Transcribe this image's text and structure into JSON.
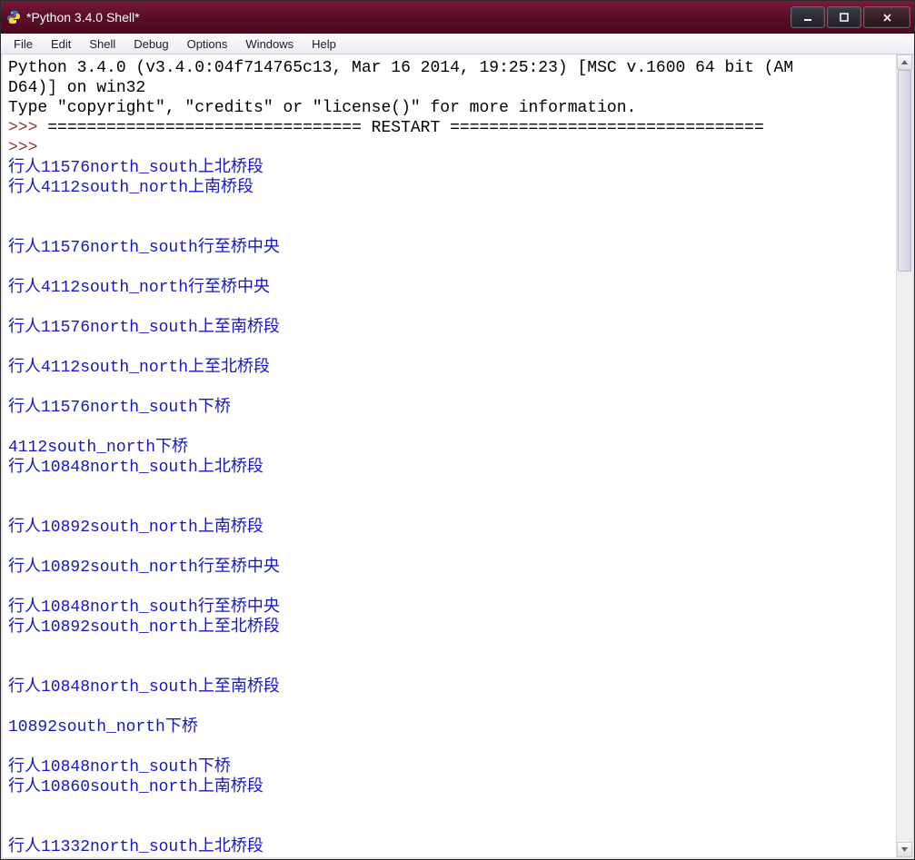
{
  "window": {
    "title": "*Python 3.4.0 Shell*"
  },
  "menubar": {
    "items": [
      "File",
      "Edit",
      "Shell",
      "Debug",
      "Options",
      "Windows",
      "Help"
    ]
  },
  "colors": {
    "prompt": "#8b3a3a",
    "output": "#1616c8",
    "black": "#000000"
  },
  "lines": [
    {
      "spans": [
        {
          "c": "black",
          "t": "Python 3.4.0 (v3.4.0:04f714765c13, Mar 16 2014, 19:25:23) [MSC v.1600 64 bit (AM"
        }
      ]
    },
    {
      "spans": [
        {
          "c": "black",
          "t": "D64)] on win32"
        }
      ]
    },
    {
      "spans": [
        {
          "c": "black",
          "t": "Type \"copyright\", \"credits\" or \"license()\" for more information."
        }
      ]
    },
    {
      "spans": [
        {
          "c": "prompt",
          "t": ">>> "
        },
        {
          "c": "black",
          "t": "================================ RESTART ================================"
        }
      ]
    },
    {
      "spans": [
        {
          "c": "prompt",
          "t": ">>> "
        }
      ]
    },
    {
      "spans": [
        {
          "c": "blue",
          "t": "行人11576north_south上北桥段"
        }
      ]
    },
    {
      "spans": [
        {
          "c": "blue",
          "t": "行人4112south_north上南桥段"
        }
      ]
    },
    {
      "spans": [
        {
          "c": "blue",
          "t": ""
        }
      ]
    },
    {
      "spans": [
        {
          "c": "blue",
          "t": ""
        }
      ]
    },
    {
      "spans": [
        {
          "c": "blue",
          "t": "行人11576north_south行至桥中央"
        }
      ]
    },
    {
      "spans": [
        {
          "c": "blue",
          "t": ""
        }
      ]
    },
    {
      "spans": [
        {
          "c": "blue",
          "t": "行人4112south_north行至桥中央"
        }
      ]
    },
    {
      "spans": [
        {
          "c": "blue",
          "t": ""
        }
      ]
    },
    {
      "spans": [
        {
          "c": "blue",
          "t": "行人11576north_south上至南桥段"
        }
      ]
    },
    {
      "spans": [
        {
          "c": "blue",
          "t": ""
        }
      ]
    },
    {
      "spans": [
        {
          "c": "blue",
          "t": "行人4112south_north上至北桥段"
        }
      ]
    },
    {
      "spans": [
        {
          "c": "blue",
          "t": ""
        }
      ]
    },
    {
      "spans": [
        {
          "c": "blue",
          "t": "行人11576north_south下桥"
        }
      ]
    },
    {
      "spans": [
        {
          "c": "blue",
          "t": ""
        }
      ]
    },
    {
      "spans": [
        {
          "c": "blue",
          "t": "4112south_north下桥"
        }
      ]
    },
    {
      "spans": [
        {
          "c": "blue",
          "t": "行人10848north_south上北桥段"
        }
      ]
    },
    {
      "spans": [
        {
          "c": "blue",
          "t": ""
        }
      ]
    },
    {
      "spans": [
        {
          "c": "blue",
          "t": ""
        }
      ]
    },
    {
      "spans": [
        {
          "c": "blue",
          "t": "行人10892south_north上南桥段"
        }
      ]
    },
    {
      "spans": [
        {
          "c": "blue",
          "t": ""
        }
      ]
    },
    {
      "spans": [
        {
          "c": "blue",
          "t": "行人10892south_north行至桥中央"
        }
      ]
    },
    {
      "spans": [
        {
          "c": "blue",
          "t": ""
        }
      ]
    },
    {
      "spans": [
        {
          "c": "blue",
          "t": "行人10848north_south行至桥中央"
        }
      ]
    },
    {
      "spans": [
        {
          "c": "blue",
          "t": "行人10892south_north上至北桥段"
        }
      ]
    },
    {
      "spans": [
        {
          "c": "blue",
          "t": ""
        }
      ]
    },
    {
      "spans": [
        {
          "c": "blue",
          "t": ""
        }
      ]
    },
    {
      "spans": [
        {
          "c": "blue",
          "t": "行人10848north_south上至南桥段"
        }
      ]
    },
    {
      "spans": [
        {
          "c": "blue",
          "t": ""
        }
      ]
    },
    {
      "spans": [
        {
          "c": "blue",
          "t": "10892south_north下桥"
        }
      ]
    },
    {
      "spans": [
        {
          "c": "blue",
          "t": ""
        }
      ]
    },
    {
      "spans": [
        {
          "c": "blue",
          "t": "行人10848north_south下桥"
        }
      ]
    },
    {
      "spans": [
        {
          "c": "blue",
          "t": "行人10860south_north上南桥段"
        }
      ]
    },
    {
      "spans": [
        {
          "c": "blue",
          "t": ""
        }
      ]
    },
    {
      "spans": [
        {
          "c": "blue",
          "t": ""
        }
      ]
    },
    {
      "spans": [
        {
          "c": "blue",
          "t": "行人11332north_south上北桥段"
        }
      ]
    }
  ]
}
